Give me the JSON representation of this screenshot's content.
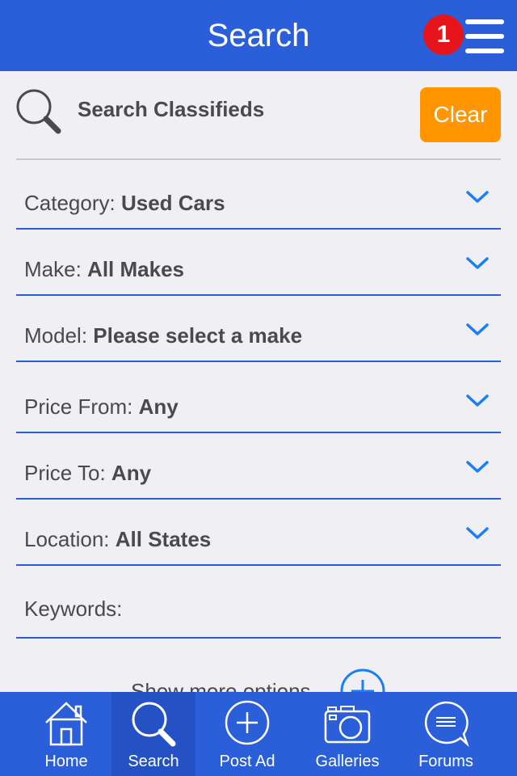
{
  "header": {
    "title": "Search",
    "notification_count": "1"
  },
  "search": {
    "title": "Search Classifieds",
    "clear_label": "Clear"
  },
  "fields": [
    {
      "label": "Category:",
      "value": "Used Cars"
    },
    {
      "label": "Make:",
      "value": "All Makes"
    },
    {
      "label": "Model:",
      "value": "Please select a make"
    },
    {
      "label": "Price From:",
      "value": "Any"
    },
    {
      "label": "Price To:",
      "value": "Any"
    },
    {
      "label": "Location:",
      "value": "All States"
    },
    {
      "label": "Keywords:",
      "value": ""
    }
  ],
  "more_options": "Show more options",
  "tabs": [
    {
      "label": "Home",
      "icon": "home-icon"
    },
    {
      "label": "Search",
      "icon": "search-icon"
    },
    {
      "label": "Post Ad",
      "icon": "plus-circle-icon"
    },
    {
      "label": "Galleries",
      "icon": "camera-icon"
    },
    {
      "label": "Forums",
      "icon": "chat-bubble-icon"
    }
  ],
  "colors": {
    "header": "#2b5fd9",
    "accent_orange": "#ff9500",
    "badge_red": "#e8141b",
    "chevron": "#1a7ef5"
  }
}
